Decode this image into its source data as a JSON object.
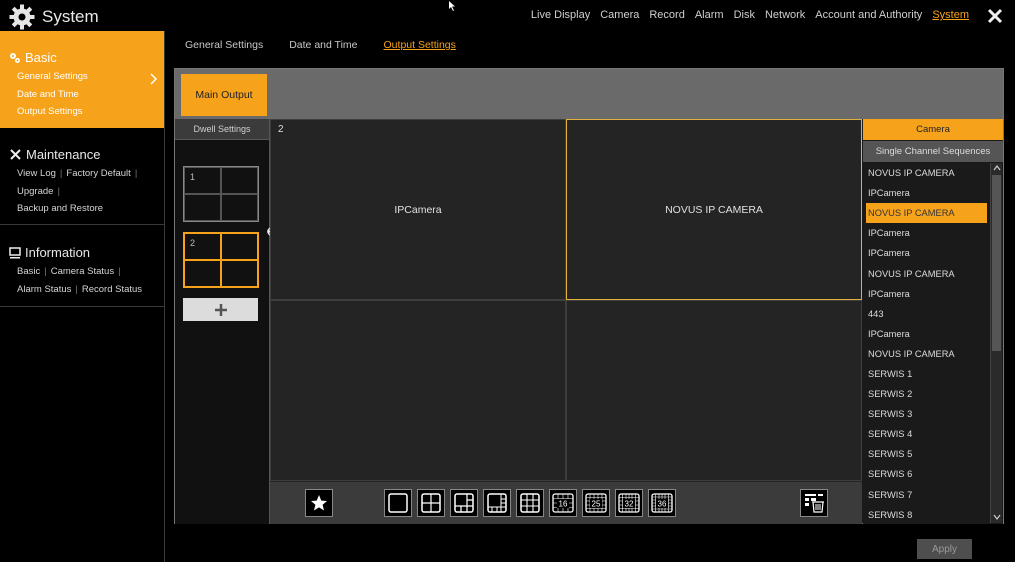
{
  "header": {
    "title": "System",
    "nav": [
      "Live Display",
      "Camera",
      "Record",
      "Alarm",
      "Disk",
      "Network",
      "Account and Authority",
      "System"
    ],
    "active_nav": "System"
  },
  "sidebar": {
    "basic": {
      "title": "Basic",
      "links": [
        "General Settings",
        "Date and Time",
        "Output Settings"
      ]
    },
    "maintenance": {
      "title": "Maintenance",
      "links": [
        "View Log",
        "Factory Default",
        "Upgrade",
        "Backup and Restore"
      ]
    },
    "information": {
      "title": "Information",
      "links": [
        "Basic",
        "Camera Status",
        "Alarm Status",
        "Record Status"
      ]
    }
  },
  "subtabs": [
    "General Settings",
    "Date and Time",
    "Output Settings"
  ],
  "active_subtab": "Output Settings",
  "main_output_label": "Main Output",
  "dwell": {
    "header": "Dwell Settings",
    "items": [
      "1",
      "2"
    ]
  },
  "grid": {
    "number": "2",
    "cells": [
      "IPCamera",
      "NOVUS IP CAMERA",
      "",
      ""
    ]
  },
  "right_panel": {
    "camera_tab": "Camera",
    "sequence_tab": "Single Channel Sequences",
    "items": [
      "NOVUS IP CAMERA",
      "IPCamera",
      "NOVUS IP CAMERA",
      "IPCamera",
      "IPCamera",
      "NOVUS IP CAMERA",
      "IPCamera",
      "443",
      "IPCamera",
      "NOVUS IP CAMERA",
      "SERWIS  1",
      "SERWIS  2",
      "SERWIS  3",
      "SERWIS  4",
      "SERWIS  5",
      "SERWIS  6",
      "SERWIS  7",
      "SERWIS  8"
    ],
    "selected_index": 2
  },
  "toolbar": {
    "layout_labels": [
      "16",
      "25",
      "32",
      "36"
    ]
  },
  "apply_label": "Apply",
  "colors": {
    "accent": "#f7a21b"
  }
}
